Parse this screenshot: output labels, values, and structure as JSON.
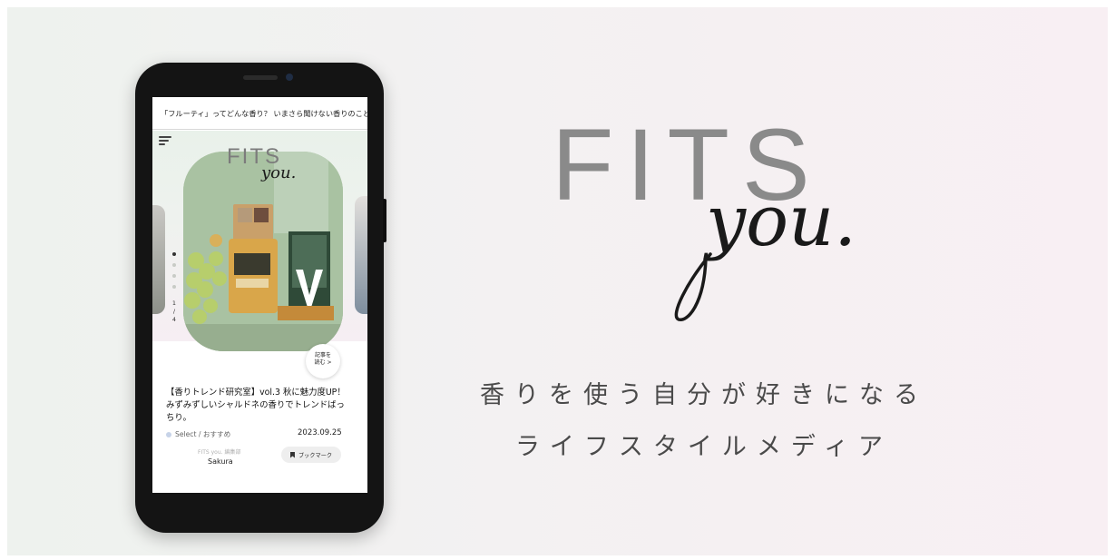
{
  "brand": {
    "logo_text": "FITS",
    "logo_script": "you.",
    "tagline_line1": "香りを使う自分が好きになる",
    "tagline_line2": "ライフスタイルメディア"
  },
  "phone": {
    "headline": "「フルーティ」ってどんな香り？ いまさら聞けない香りのこと",
    "mini_logo_text": "FITS",
    "mini_logo_script": "you.",
    "slide_counter": {
      "current": "1",
      "separator": "/",
      "total": "4"
    },
    "read_more_line1": "記事を",
    "read_more_line2": "読む >",
    "article": {
      "title": "【香りトレンド研究室】vol.3 秋に魅力度UP！みずみずしいシャルドネの香りでトレンドばっちり。",
      "category": "Select / おすすめ",
      "date": "2023.09.25",
      "author_role": "FITS you. 編集部",
      "author_name": "Sakura",
      "bookmark_label": "ブックマーク"
    }
  },
  "colors": {
    "logo_gray": "#8a8a8a",
    "script_black": "#1a1a1a",
    "bg_left": "#eef2ee",
    "bg_right": "#f8eff3"
  }
}
